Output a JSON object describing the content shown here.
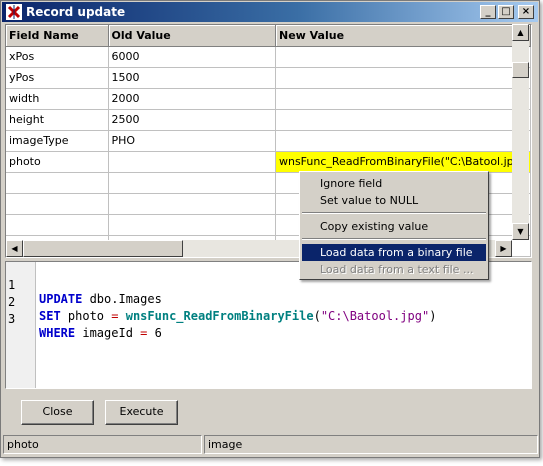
{
  "window": {
    "title": "Record update",
    "minimize_glyph": "_",
    "maximize_glyph": "□",
    "close_glyph": "×"
  },
  "grid": {
    "columns": [
      "Field Name",
      "Old Value",
      "New Value"
    ],
    "rows": [
      {
        "field": "xPos",
        "old": "6000",
        "new": ""
      },
      {
        "field": "yPos",
        "old": "1500",
        "new": ""
      },
      {
        "field": "width",
        "old": "2000",
        "new": ""
      },
      {
        "field": "height",
        "old": "2500",
        "new": ""
      },
      {
        "field": "imageType",
        "old": "PHO",
        "new": ""
      },
      {
        "field": "photo",
        "old": "",
        "new": "wnsFunc_ReadFromBinaryFile(\"C:\\Batool.jpg\")"
      }
    ],
    "ellipsis_label": "...",
    "editing_color": "#ffff00"
  },
  "context_menu": {
    "items": [
      {
        "label": "Ignore field"
      },
      {
        "label": "Set value to NULL"
      },
      {
        "label": "Copy existing value"
      },
      {
        "label": "Load data from a binary file ..."
      },
      {
        "label": "Load data from a text file ..."
      }
    ]
  },
  "sql": {
    "line_numbers": [
      "1",
      "2",
      "3"
    ],
    "l1": {
      "kw": "UPDATE",
      "rest": " dbo.Images"
    },
    "l2": {
      "kw": "SET",
      "rest": " photo ",
      "op": "=",
      "sp": " ",
      "fn": "wnsFunc_ReadFromBinaryFile",
      "open": "(",
      "str": "\"C:\\Batool.jpg\"",
      "close": ")"
    },
    "l3": {
      "kw": "WHERE",
      "rest": " imageId ",
      "op": "=",
      "val": " 6"
    }
  },
  "buttons": {
    "close": "Close",
    "execute": "Execute"
  },
  "status": {
    "left": "photo",
    "right": "image"
  }
}
